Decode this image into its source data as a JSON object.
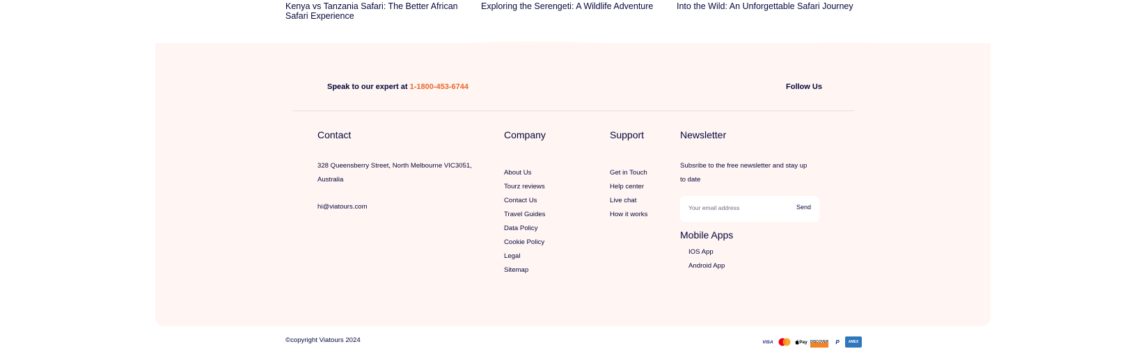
{
  "articles": [
    {
      "title": "Kenya vs Tanzania Safari: The Better African Safari Experience"
    },
    {
      "title": "Exploring the Serengeti: A Wildlife Adventure"
    },
    {
      "title": "Into the Wild: An Unforgettable Safari Journey"
    }
  ],
  "topbar": {
    "expert_prefix": "Speak to our expert at",
    "phone": "1-1800-453-6744",
    "follow": "Follow Us"
  },
  "contact": {
    "title": "Contact",
    "address": "328 Queensberry Street, North Melbourne VIC3051, Australia",
    "email": "hi@viatours.com"
  },
  "company": {
    "title": "Company",
    "links": [
      "About Us",
      "Tourz reviews",
      "Contact Us",
      "Travel Guides",
      "Data Policy",
      "Cookie Policy",
      "Legal",
      "Sitemap"
    ]
  },
  "support": {
    "title": "Support",
    "links": [
      "Get in Touch",
      "Help center",
      "Live chat",
      "How it works"
    ]
  },
  "newsletter": {
    "title": "Newsletter",
    "description": "Subsribe to the free newsletter and stay up to date",
    "placeholder": "Your email address",
    "send": "Send"
  },
  "mobile_apps": {
    "title": "Mobile Apps",
    "links": [
      "IOS App",
      "Android App"
    ]
  },
  "bottom": {
    "copyright": "©copyright Viatours 2024",
    "payments": [
      {
        "icon": "visa-icon",
        "label": "VISA"
      },
      {
        "icon": "mastercard-icon",
        "label": ""
      },
      {
        "icon": "apple-pay-icon",
        "label": "Pay"
      },
      {
        "icon": "discover-icon",
        "label": "DISCOVER"
      },
      {
        "icon": "paypal-icon",
        "label": "P"
      },
      {
        "icon": "amex-icon",
        "label": "AMEX"
      }
    ]
  },
  "colors": {
    "accent": "#eb662b",
    "text": "#05073c",
    "footer_bg": "#fff5f2"
  }
}
